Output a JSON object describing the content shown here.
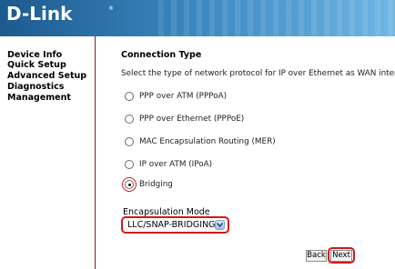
{
  "header": {
    "logo": "D-Link",
    "logo_registered": "®"
  },
  "sidebar": {
    "items": [
      {
        "label": "Device Info"
      },
      {
        "label": "Quick Setup"
      },
      {
        "label": "Advanced Setup"
      },
      {
        "label": "Diagnostics"
      },
      {
        "label": "Management"
      }
    ]
  },
  "main": {
    "title": "Connection Type",
    "description": "Select the type of network protocol for IP over Ethernet as WAN interface",
    "options": [
      {
        "label": "PPP over ATM (PPPoA)",
        "selected": false
      },
      {
        "label": "PPP over Ethernet (PPPoE)",
        "selected": false
      },
      {
        "label": "MAC Encapsulation Routing (MER)",
        "selected": false
      },
      {
        "label": "IP over ATM (IPoA)",
        "selected": false
      },
      {
        "label": "Bridging",
        "selected": true
      }
    ],
    "encapsulation": {
      "label": "Encapsulation Mode",
      "selected": "LLC/SNAP-BRIDGING"
    },
    "buttons": {
      "back": "Back",
      "next": "Next"
    }
  },
  "colors": {
    "highlight": "#d11a1a",
    "header_dark": "#1c5a8f",
    "header_light": "#6fb6e4",
    "divider": "#8a1c1c"
  }
}
